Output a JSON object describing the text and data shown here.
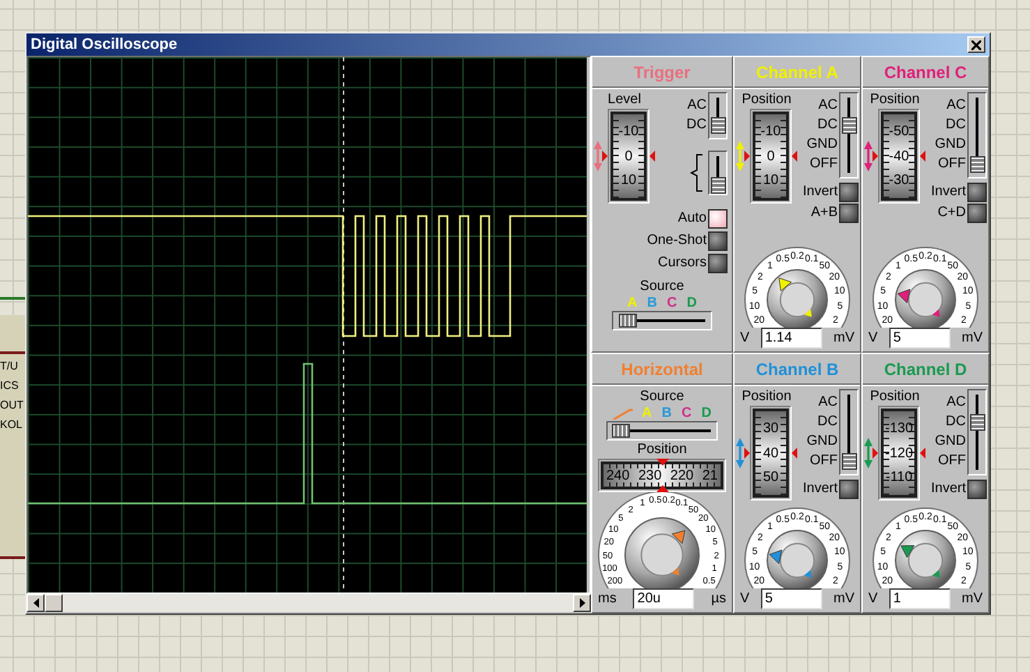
{
  "background": {
    "labels": [
      "T/U",
      "ICS",
      "OUT",
      "KOL"
    ]
  },
  "window": {
    "title": "Digital Oscilloscope"
  },
  "panels": [
    {
      "kind": "trigger",
      "title": "Trigger",
      "color": "#e8707f",
      "level_label": "Level",
      "scale": [
        "-10",
        "0",
        "10"
      ],
      "coupling": [
        {
          "label": "AC",
          "selected": false
        },
        {
          "label": "DC",
          "selected": true
        }
      ],
      "edge_switch": {
        "on": true
      },
      "buttons": [
        {
          "label": "Auto",
          "on": true
        },
        {
          "label": "One-Shot",
          "on": false
        },
        {
          "label": "Cursors",
          "on": false
        }
      ],
      "source_label": "Source",
      "sources": [
        {
          "kind": "letter",
          "label": "A",
          "color": "#f0f000",
          "selected": true
        },
        {
          "kind": "letter",
          "label": "B",
          "color": "#2a9ad8",
          "selected": false
        },
        {
          "kind": "letter",
          "label": "C",
          "color": "#d0308a",
          "selected": false
        },
        {
          "kind": "letter",
          "label": "D",
          "color": "#1a9a50",
          "selected": false
        }
      ]
    },
    {
      "kind": "channel",
      "title": "Channel A",
      "color": "#f0f000",
      "position_label": "Position",
      "scale": [
        "-10",
        "0",
        "10"
      ],
      "coupling": [
        {
          "label": "AC",
          "selected": false
        },
        {
          "label": "DC",
          "selected": true
        },
        {
          "label": "GND",
          "selected": false
        },
        {
          "label": "OFF",
          "selected": false
        }
      ],
      "toggles": [
        {
          "label": "Invert",
          "on": false
        },
        {
          "label": "A+B",
          "on": false
        }
      ],
      "dial": {
        "left_marks": [
          "0.2",
          "0.5",
          "1",
          "2",
          "5",
          "10",
          "20"
        ],
        "right_marks": [
          "0.1",
          "50",
          "20",
          "10",
          "5",
          "2"
        ],
        "level": 0.33
      },
      "unit_left": "V",
      "value": "1.14",
      "unit_right": "mV"
    },
    {
      "kind": "channel",
      "title": "Channel C",
      "color": "#e0207a",
      "position_label": "Position",
      "scale": [
        "-50",
        "-40",
        "-30"
      ],
      "coupling": [
        {
          "label": "AC",
          "selected": false
        },
        {
          "label": "DC",
          "selected": false
        },
        {
          "label": "GND",
          "selected": false
        },
        {
          "label": "OFF",
          "selected": true
        }
      ],
      "toggles": [
        {
          "label": "Invert",
          "on": false
        },
        {
          "label": "C+D",
          "on": false
        }
      ],
      "dial": {
        "left_marks": [
          "0.2",
          "0.5",
          "1",
          "2",
          "5",
          "10",
          "20"
        ],
        "right_marks": [
          "0.1",
          "50",
          "20",
          "10",
          "5",
          "2"
        ],
        "level": 0.17
      },
      "unit_left": "V",
      "value": "5",
      "unit_right": "mV"
    },
    {
      "kind": "horizontal",
      "title": "Horizontal",
      "color": "#f08030",
      "source_label": "Source",
      "sources": [
        {
          "kind": "ramp",
          "selected": true
        },
        {
          "kind": "letter",
          "label": "A",
          "color": "#f0f000",
          "selected": false
        },
        {
          "kind": "letter",
          "label": "B",
          "color": "#2a9ad8",
          "selected": false
        },
        {
          "kind": "letter",
          "label": "C",
          "color": "#d0308a",
          "selected": false
        },
        {
          "kind": "letter",
          "label": "D",
          "color": "#1a9a50",
          "selected": false
        }
      ],
      "position_label": "Position",
      "scale": [
        "240",
        "230",
        "220",
        "21"
      ],
      "dial": {
        "left_marks": [
          "0.5",
          "1",
          "2",
          "5",
          "10",
          "20",
          "50",
          "100",
          "200"
        ],
        "right_marks": [
          "0.2",
          "0.1",
          "50",
          "20",
          "10",
          "5",
          "2",
          "1",
          "0.5"
        ],
        "level": 0.68
      },
      "unit_left": "ms",
      "value": "20u",
      "unit_right": "µs"
    },
    {
      "kind": "channel",
      "title": "Channel B",
      "color": "#2090d8",
      "position_label": "Position",
      "scale": [
        "30",
        "40",
        "50"
      ],
      "coupling": [
        {
          "label": "AC",
          "selected": false
        },
        {
          "label": "DC",
          "selected": false
        },
        {
          "label": "GND",
          "selected": false
        },
        {
          "label": "OFF",
          "selected": true
        }
      ],
      "toggles": [
        {
          "label": "Invert",
          "on": false
        }
      ],
      "dial": {
        "left_marks": [
          "0.2",
          "0.5",
          "1",
          "2",
          "5",
          "10",
          "20"
        ],
        "right_marks": [
          "0.1",
          "50",
          "20",
          "10",
          "5",
          "2"
        ],
        "level": 0.17
      },
      "unit_left": "V",
      "value": "5",
      "unit_right": "mV"
    },
    {
      "kind": "channel",
      "title": "Channel D",
      "color": "#1a9a50",
      "position_label": "Position",
      "scale": [
        "-130",
        "-120",
        "-110"
      ],
      "coupling": [
        {
          "label": "AC",
          "selected": false
        },
        {
          "label": "DC",
          "selected": true
        },
        {
          "label": "GND",
          "selected": false
        },
        {
          "label": "OFF",
          "selected": false
        }
      ],
      "toggles": [
        {
          "label": "Invert",
          "on": false
        }
      ],
      "dial": {
        "left_marks": [
          "0.2",
          "0.5",
          "1",
          "2",
          "5",
          "10",
          "20"
        ],
        "right_marks": [
          "0.1",
          "50",
          "20",
          "10",
          "5",
          "2"
        ],
        "level": 0.25
      },
      "unit_left": "V",
      "value": "1",
      "unit_right": "mV"
    }
  ]
}
